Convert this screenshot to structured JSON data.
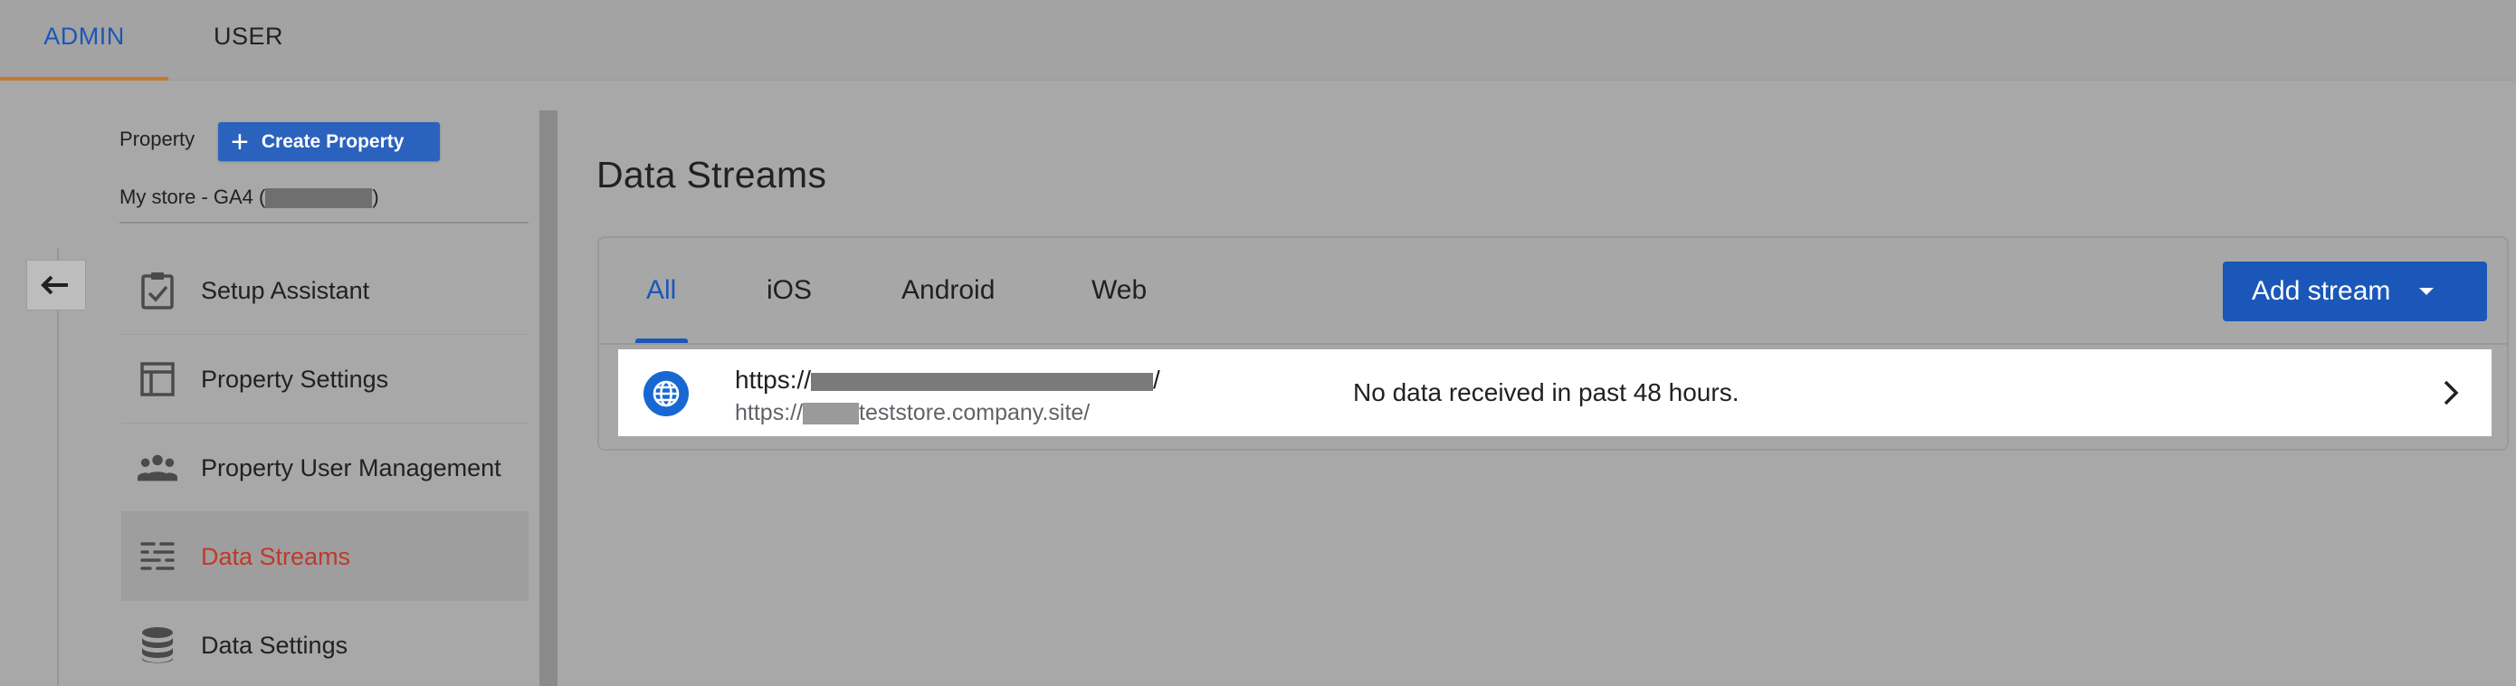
{
  "top_tabs": {
    "admin": "ADMIN",
    "user": "USER"
  },
  "sidebar": {
    "property_label": "Property",
    "create_property_label": "Create Property",
    "property_name_prefix": "My store - GA4 (",
    "property_name_suffix": ")",
    "items": [
      {
        "label": "Setup Assistant",
        "icon": "clipboard-check-icon"
      },
      {
        "label": "Property Settings",
        "icon": "layout-icon"
      },
      {
        "label": "Property User Management",
        "icon": "people-icon"
      },
      {
        "label": "Data Streams",
        "icon": "streams-icon",
        "active": true
      },
      {
        "label": "Data Settings",
        "icon": "database-icon"
      }
    ]
  },
  "main": {
    "title": "Data Streams",
    "tabs": [
      "All",
      "iOS",
      "Android",
      "Web"
    ],
    "active_tab": "All",
    "add_stream_label": "Add stream",
    "streams": [
      {
        "name_prefix": "https://",
        "name_suffix": "/",
        "url_prefix": "https://",
        "url_suffix": "teststore.company.site/",
        "status": "No data received in past 48 hours.",
        "icon": "globe-icon"
      }
    ]
  },
  "colors": {
    "accent_blue": "#1a57b8",
    "active_nav_red": "#c0392b",
    "admin_underline": "#c7782a"
  }
}
